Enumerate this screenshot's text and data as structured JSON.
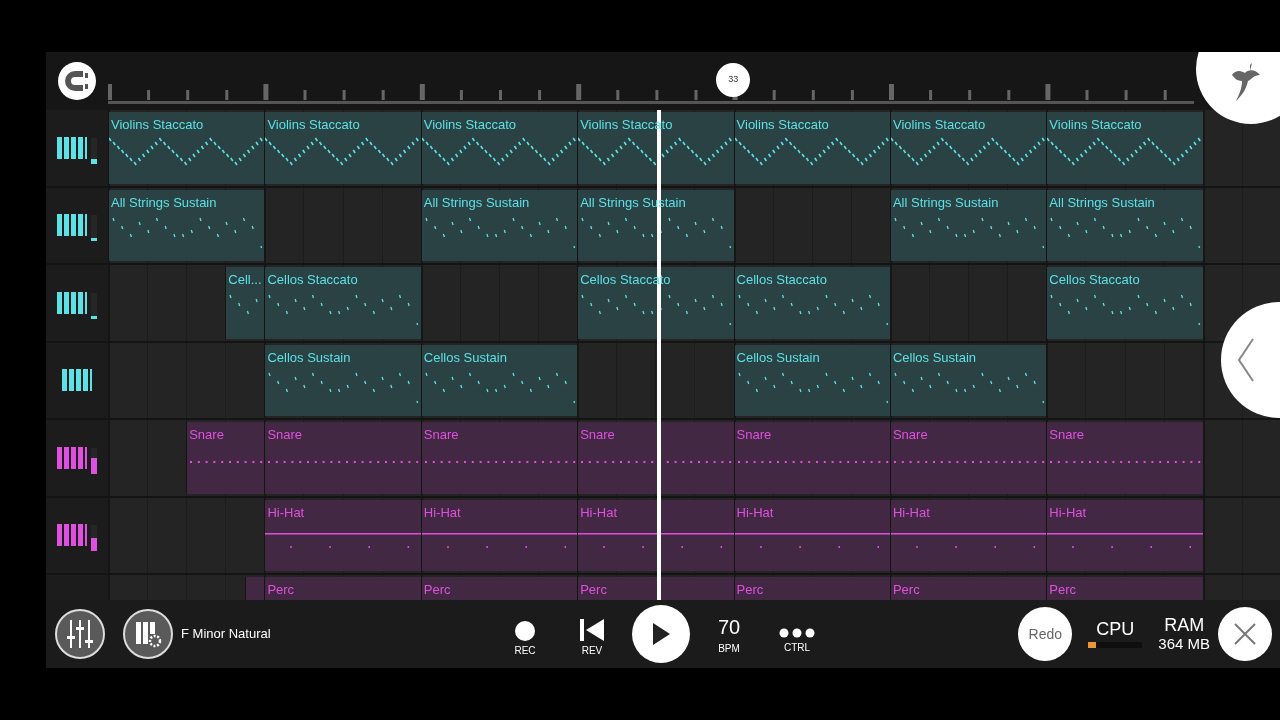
{
  "ruler": {
    "marker": {
      "label": "33",
      "level": 0.533
    }
  },
  "playhead": {
    "level": 0.47
  },
  "tracks": [
    {
      "color": "#5ce1e6",
      "level": 0.2,
      "kind": "zigzag",
      "slots": [
        {
          "kind": "clip",
          "label": "Violins Staccato"
        },
        {
          "kind": "clip",
          "label": "Violins Staccato"
        },
        {
          "kind": "clip",
          "label": "Violins Staccato"
        },
        {
          "kind": "clip",
          "label": "Violins Staccato"
        },
        {
          "kind": "clip",
          "label": "Violins Staccato"
        },
        {
          "kind": "clip",
          "label": "Violins Staccato"
        },
        {
          "kind": "clip",
          "label": "Violins Staccato"
        }
      ]
    },
    {
      "color": "#5ce1e6",
      "level": 0.12,
      "kind": "sparse",
      "slots": [
        {
          "kind": "clip",
          "label": "All Strings Sustain"
        },
        {
          "kind": "empty"
        },
        {
          "kind": "clip",
          "label": "All Strings Sustain"
        },
        {
          "kind": "clip",
          "label": "All Strings Sustain"
        },
        {
          "kind": "empty"
        },
        {
          "kind": "clip",
          "label": "All Strings Sustain"
        },
        {
          "kind": "clip",
          "label": "All Strings Sustain"
        }
      ]
    },
    {
      "color": "#5ce1e6",
      "level": 0.12,
      "kind": "sparse",
      "slots": [
        {
          "kind": "rest"
        },
        {
          "kind": "rest"
        },
        {
          "kind": "rest"
        },
        {
          "kind": "beat-clip",
          "label": "Cell..."
        },
        {
          "kind": "clip",
          "label": "Cellos Staccato"
        },
        {
          "kind": "empty"
        },
        {
          "kind": "clip",
          "label": "Cellos Staccato"
        },
        {
          "kind": "clip",
          "label": "Cellos Staccato"
        },
        {
          "kind": "empty"
        },
        {
          "kind": "clip",
          "label": "Cellos Staccato"
        }
      ]
    },
    {
      "color": "#5ce1e6",
      "kind": "sparse",
      "slots": [
        {
          "kind": "empty"
        },
        {
          "kind": "clip",
          "label": "Cellos Sustain"
        },
        {
          "kind": "clip",
          "label": "Cellos Sustain"
        },
        {
          "kind": "empty"
        },
        {
          "kind": "clip",
          "label": "Cellos Sustain"
        },
        {
          "kind": "clip",
          "label": "Cellos Sustain"
        },
        {
          "kind": "empty"
        }
      ]
    },
    {
      "color": "#e050e0",
      "level": 0.6,
      "kind": "dotted",
      "slots": [
        {
          "kind": "rest"
        },
        {
          "kind": "rest"
        },
        {
          "kind": "half-clip",
          "label": "Snare"
        },
        {
          "kind": "clip",
          "label": "Snare"
        },
        {
          "kind": "clip",
          "label": "Snare"
        },
        {
          "kind": "clip",
          "label": "Snare"
        },
        {
          "kind": "clip",
          "label": "Snare"
        },
        {
          "kind": "clip",
          "label": "Snare"
        },
        {
          "kind": "clip",
          "label": "Snare"
        }
      ]
    },
    {
      "color": "#e050e0",
      "level": 0.5,
      "kind": "hihat",
      "slots": [
        {
          "kind": "empty"
        },
        {
          "kind": "clip",
          "label": "Hi-Hat"
        },
        {
          "kind": "clip",
          "label": "Hi-Hat"
        },
        {
          "kind": "clip",
          "label": "Hi-Hat"
        },
        {
          "kind": "clip",
          "label": "Hi-Hat"
        },
        {
          "kind": "clip",
          "label": "Hi-Hat"
        },
        {
          "kind": "clip",
          "label": "Hi-Hat"
        }
      ]
    },
    {
      "color": "#e050e0",
      "kind": "none",
      "slots": [
        {
          "kind": "rest"
        },
        {
          "kind": "rest"
        },
        {
          "kind": "rest"
        },
        {
          "kind": "half-rest"
        },
        {
          "kind": "tiny-clip"
        },
        {
          "kind": "clip",
          "label": "Perc"
        },
        {
          "kind": "clip",
          "label": "Perc"
        },
        {
          "kind": "clip",
          "label": "Perc"
        },
        {
          "kind": "clip",
          "label": "Perc"
        },
        {
          "kind": "clip",
          "label": "Perc"
        },
        {
          "kind": "clip",
          "label": "Perc"
        }
      ]
    }
  ],
  "bottom_bar": {
    "scale": "F Minor Natural",
    "transport": [
      {
        "kind": "rec",
        "label": "REC"
      },
      {
        "kind": "rev",
        "label": "REV"
      },
      {
        "kind": "play"
      },
      {
        "kind": "bpm",
        "value": "70",
        "label": "BPM"
      },
      {
        "kind": "ctrl",
        "label": "CTRL"
      }
    ],
    "redo": "Redo",
    "cpu": {
      "label": "CPU",
      "level": 0.15
    },
    "ram": {
      "label": "RAM",
      "value": "364 MB"
    }
  }
}
